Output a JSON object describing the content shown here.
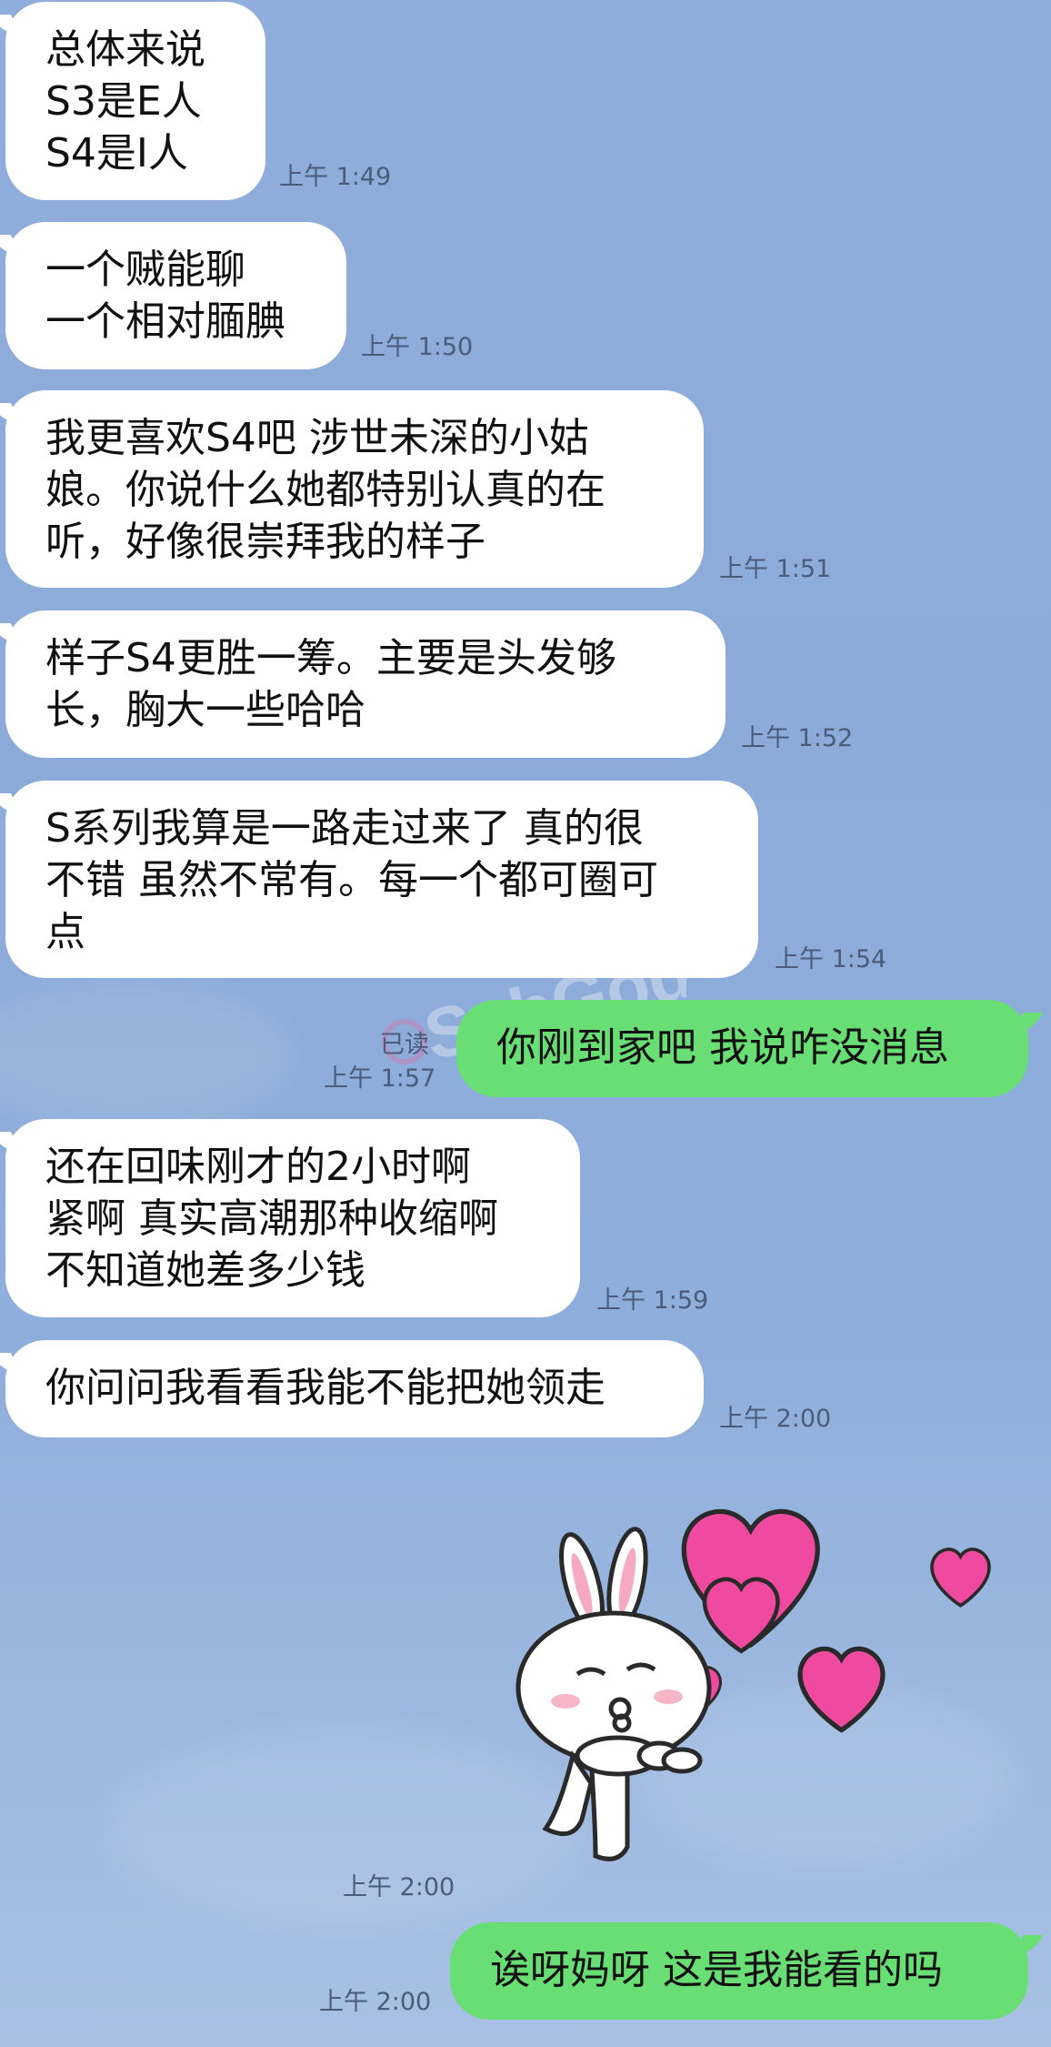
{
  "colors": {
    "background": "#8cabd9",
    "incoming_bubble": "#ffffff",
    "outgoing_bubble": "#69de74",
    "timestamp_text": "#4a5c7a"
  },
  "messages": [
    {
      "direction": "incoming",
      "text": "总体来说\nS3是E人\nS4是I人",
      "time": "上午 1:49"
    },
    {
      "direction": "incoming",
      "text": "一个贼能聊\n一个相对腼腆",
      "time": "上午 1:50"
    },
    {
      "direction": "incoming",
      "text": "我更喜欢S4吧 涉世未深的小姑\n娘。你说什么她都特别认真的在\n听，好像很崇拜我的样子",
      "time": "上午 1:51"
    },
    {
      "direction": "incoming",
      "text": "样子S4更胜一筹。主要是头发够\n长，胸大一些哈哈",
      "time": "上午 1:52"
    },
    {
      "direction": "incoming",
      "text": "S系列我算是一路走过来了 真的很\n不错 虽然不常有。每一个都可圈可\n点",
      "time": "上午 1:54"
    },
    {
      "direction": "outgoing",
      "text": "你刚到家吧 我说咋没消息",
      "read": "已读",
      "time": "上午 1:57"
    },
    {
      "direction": "incoming",
      "text": "还在回味刚才的2小时啊\n紧啊 真实高潮那种收缩啊\n不知道她差多少钱",
      "time": "上午 1:59"
    },
    {
      "direction": "incoming",
      "text": "你问问我看看我能不能把她领走",
      "time": "上午 2:00"
    },
    {
      "direction": "incoming",
      "type": "sticker",
      "sticker": "bunny-blowing-kiss-hearts-icon",
      "time": "上午 2:00"
    },
    {
      "direction": "outgoing",
      "text": "诶呀妈呀 这是我能看的吗",
      "time": "上午 2:00"
    }
  ]
}
